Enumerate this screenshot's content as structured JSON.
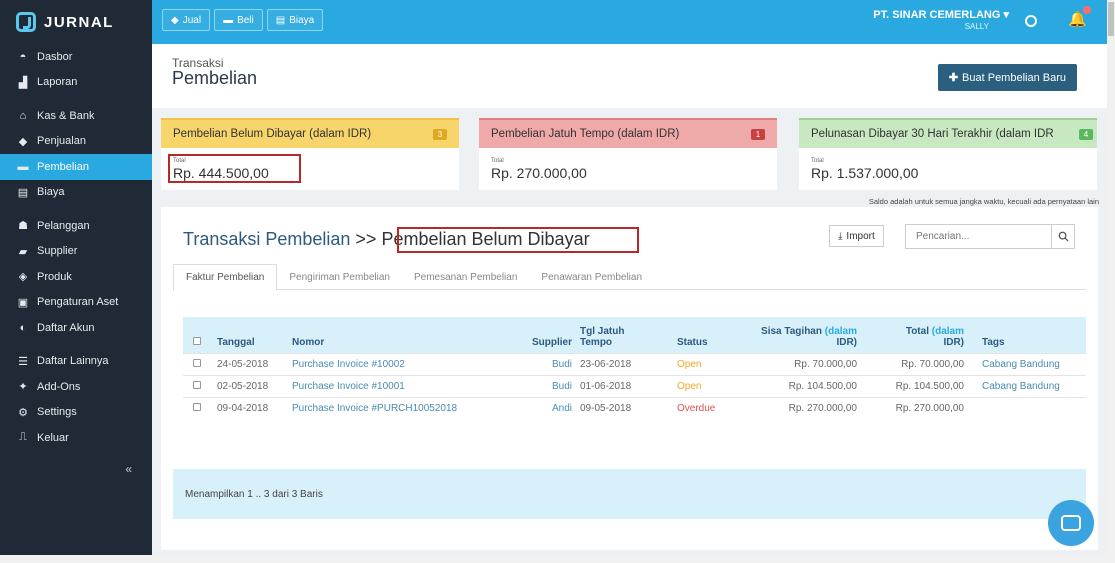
{
  "app": {
    "logo_text": "JURNAL"
  },
  "sidebar": {
    "groups": [
      [
        {
          "label": "Dasbor",
          "icon": "gauge-icon"
        },
        {
          "label": "Laporan",
          "icon": "chart-icon"
        }
      ],
      [
        {
          "label": "Kas & Bank",
          "icon": "bank-icon"
        },
        {
          "label": "Penjualan",
          "icon": "tag-icon"
        },
        {
          "label": "Pembelian",
          "icon": "cart-icon",
          "active": true
        },
        {
          "label": "Biaya",
          "icon": "receipt-icon"
        }
      ],
      [
        {
          "label": "Pelanggan",
          "icon": "users-icon"
        },
        {
          "label": "Supplier",
          "icon": "truck-icon"
        },
        {
          "label": "Produk",
          "icon": "cube-icon"
        },
        {
          "label": "Pengaturan Aset",
          "icon": "asset-icon"
        },
        {
          "label": "Daftar Akun",
          "icon": "book-icon"
        }
      ],
      [
        {
          "label": "Daftar Lainnya",
          "icon": "list-icon"
        },
        {
          "label": "Add-Ons",
          "icon": "puzzle-icon"
        },
        {
          "label": "Settings",
          "icon": "gear-icon"
        },
        {
          "label": "Keluar",
          "icon": "logout-icon"
        }
      ]
    ],
    "collapse_label": "«"
  },
  "topbar": {
    "quick": [
      {
        "label": "Jual",
        "icon": "tag-icon"
      },
      {
        "label": "Beli",
        "icon": "card-icon"
      },
      {
        "label": "Biaya",
        "icon": "receipt-icon"
      }
    ],
    "company": "PT. SINAR CEMERLANG ▾",
    "user": "SALLY"
  },
  "header": {
    "subtitle": "Transaksi",
    "title": "Pembelian",
    "new_button": "Buat Pembelian Baru"
  },
  "cards": [
    {
      "title": "Pembelian Belum Dibayar (dalam IDR)",
      "badge": "3",
      "small": "Total",
      "value": "Rp. 444.500,00"
    },
    {
      "title": "Pembelian Jatuh Tempo (dalam IDR)",
      "badge": "1",
      "small": "Total",
      "value": "Rp. 270.000,00"
    },
    {
      "title": "Pelunasan Dibayar 30 Hari Terakhir (dalam IDR",
      "badge": "4",
      "small": "Total",
      "value": "Rp. 1.537.000,00"
    }
  ],
  "note": "Saldo adalah untuk semua jangka waktu, kecuali ada pernyataan lain",
  "panel": {
    "title_link": "Transaksi Pembelian",
    "title_sep": ">>",
    "title_current": "Pembelian Belum Dibayar",
    "import_label": "Import",
    "search_placeholder": "Pencarian...",
    "tabs": [
      "Faktur Pembelian",
      "Pengiriman Pembelian",
      "Pemesanan Pembelian",
      "Penawaran Pembelian"
    ],
    "columns": {
      "tanggal": "Tanggal",
      "nomor": "Nomor",
      "supplier": "Supplier",
      "tgl_a": "Tgl Jatuh",
      "tgl_b": "Tempo",
      "status": "Status",
      "sisa_a": "Sisa Tagihan",
      "sisa_b": "(dalam",
      "sisa_c": "IDR)",
      "total_a": "Total",
      "total_b": "(dalam",
      "total_c": "IDR)",
      "tags": "Tags"
    },
    "rows": [
      {
        "tanggal": "24-05-2018",
        "nomor": "Purchase Invoice #10002",
        "supplier": "Budi",
        "tempo": "23-06-2018",
        "status": "Open",
        "sisa": "Rp. 70.000,00",
        "total": "Rp. 70.000,00",
        "tags": "Cabang Bandung"
      },
      {
        "tanggal": "02-05-2018",
        "nomor": "Purchase Invoice #10001",
        "supplier": "Budi",
        "tempo": "01-06-2018",
        "status": "Open",
        "sisa": "Rp. 104.500,00",
        "total": "Rp. 104.500,00",
        "tags": "Cabang Bandung"
      },
      {
        "tanggal": "09-04-2018",
        "nomor": "Purchase Invoice #PURCH10052018",
        "supplier": "Andi",
        "tempo": "09-05-2018",
        "status": "Overdue",
        "sisa": "Rp. 270.000,00",
        "total": "Rp. 270.000,00",
        "tags": ""
      }
    ],
    "footer": "Menampilkan 1 .. 3 dari 3 Baris"
  },
  "colors": {
    "accent": "#2aa9e0",
    "sidebar": "#1f2a36",
    "card_yellow": "#f7d56a",
    "card_red": "#f0a9a9",
    "card_green": "#c8e8c2"
  }
}
